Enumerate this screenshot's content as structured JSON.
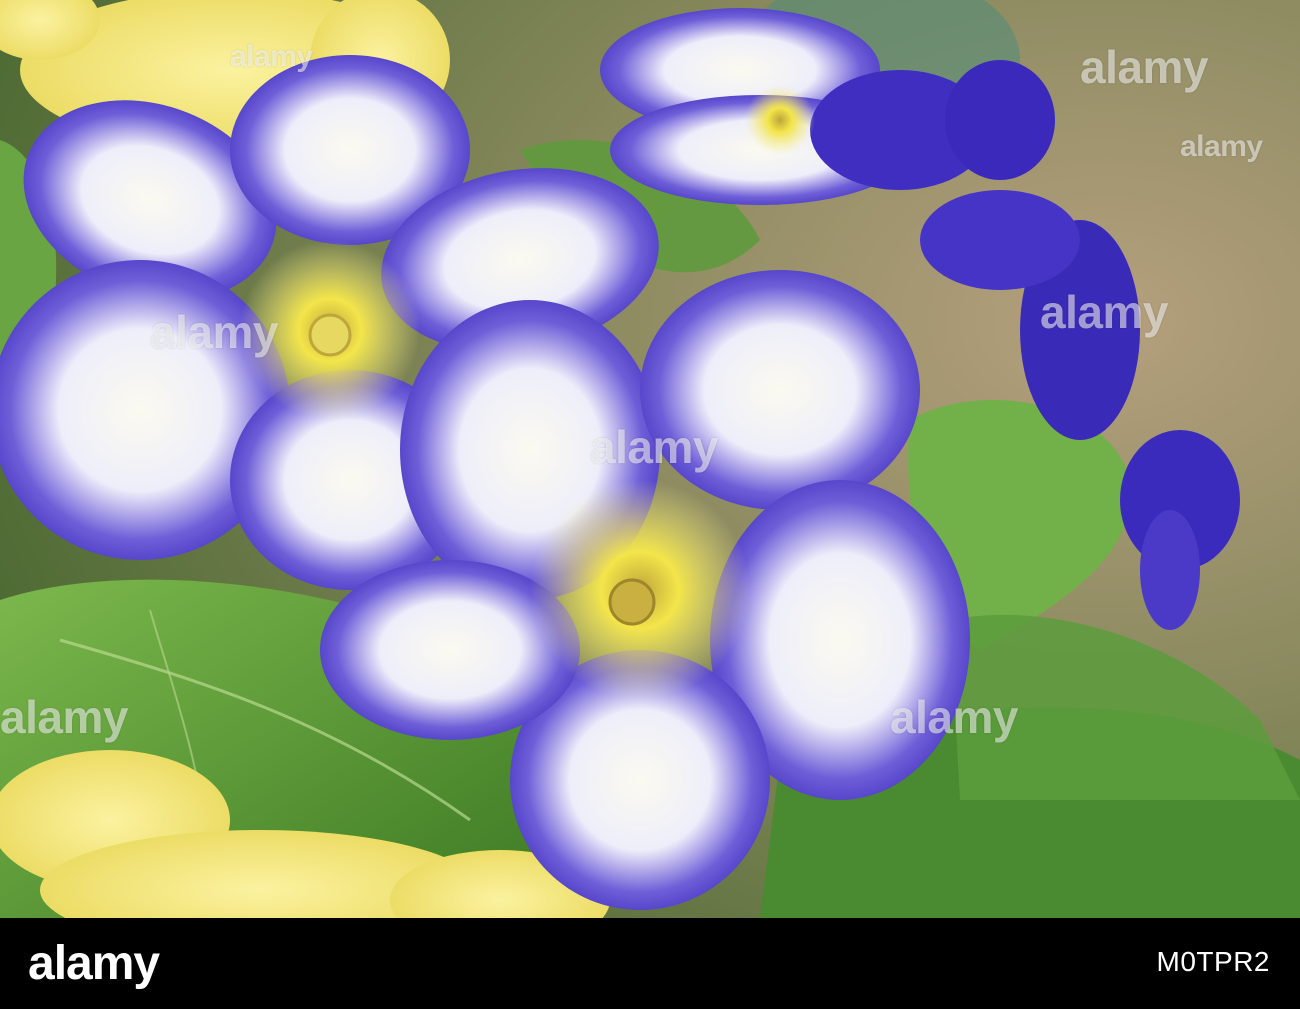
{
  "photo": {
    "subject": "blue-white-primrose-flowers",
    "colors": {
      "petal_blue": "#3b2bc4",
      "petal_white": "#f3f2fb",
      "center_yellow": "#f2e64a",
      "leaf_green": "#5d9a35",
      "yellow_flower": "#f4e77a",
      "background_tan": "#a89474"
    }
  },
  "watermark": {
    "text": "alamy"
  },
  "footer": {
    "logo": "alamy",
    "image_id": "M0TPR2"
  }
}
